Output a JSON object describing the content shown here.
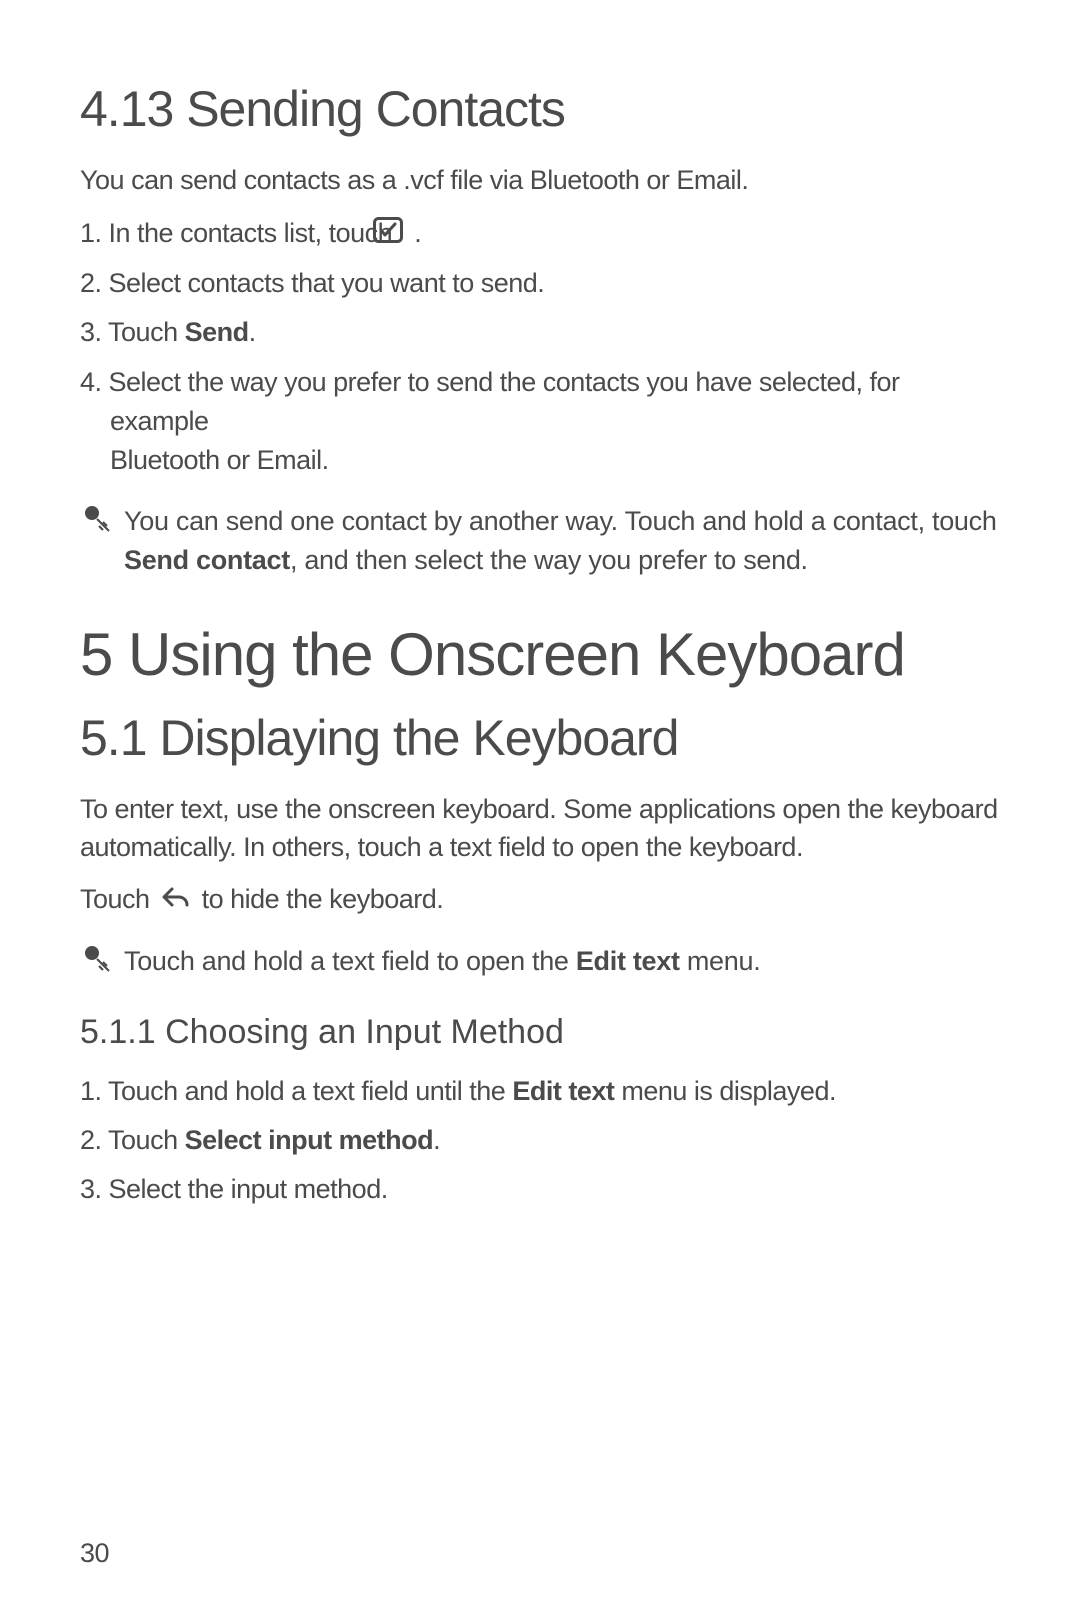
{
  "s413": {
    "heading": "4.13  Sending Contacts",
    "intro": "You can send contacts as a .vcf file via Bluetooth or Email.",
    "step1_a": "1. In the contacts list, touch ",
    "step1_b": " .",
    "step2": "2. Select contacts that you want to send.",
    "step3_a": "3. Touch ",
    "step3_b": "Send",
    "step3_c": ".",
    "step4_a": "4. Select the way you prefer to send the contacts you have selected, for example",
    "step4_b": "Bluetooth or Email.",
    "tip_a": "You can send one contact by another way. Touch and hold a contact, touch ",
    "tip_b": "Send contact",
    "tip_c": ", and then select the way you prefer to send."
  },
  "s5": {
    "heading": "5  Using the Onscreen Keyboard"
  },
  "s51": {
    "heading": "5.1  Displaying the Keyboard",
    "intro": "To enter text, use the onscreen keyboard. Some applications open the keyboard automatically. In others, touch a text field to open the keyboard.",
    "hide_a": "Touch ",
    "hide_b": " to hide the keyboard.",
    "tip_a": "Touch and hold a text field to open the ",
    "tip_b": "Edit text",
    "tip_c": " menu."
  },
  "s511": {
    "heading": "5.1.1  Choosing an Input Method",
    "step1_a": "1. Touch and hold a text field until the ",
    "step1_b": "Edit text",
    "step1_c": " menu is displayed.",
    "step2_a": "2. Touch ",
    "step2_b": "Select input method",
    "step2_c": ".",
    "step3": "3. Select the input method."
  },
  "page_number": "30"
}
